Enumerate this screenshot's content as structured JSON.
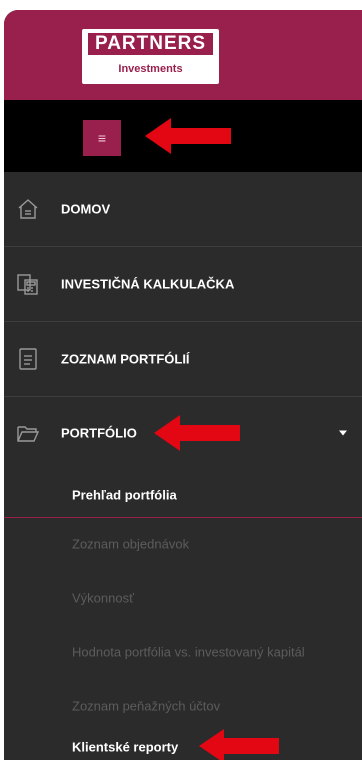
{
  "brand": {
    "line1": "PARTNERS",
    "line2": "Investments"
  },
  "menu_toggle": {
    "icon": "≡"
  },
  "nav": {
    "items": [
      {
        "label": "DOMOV",
        "icon": "home-icon"
      },
      {
        "label": "INVESTIČNÁ KALKULAČKA",
        "icon": "calculator-icon"
      },
      {
        "label": "ZOZNAM PORTFÓLIÍ",
        "icon": "document-list-icon"
      },
      {
        "label": "PORTFÓLIO",
        "icon": "folder-icon"
      }
    ]
  },
  "submenu": {
    "items": [
      {
        "label": "Prehľad portfólia",
        "state": "active"
      },
      {
        "label": "Zoznam objednávok",
        "state": "muted"
      },
      {
        "label": "Výkonnosť",
        "state": "muted"
      },
      {
        "label": "Hodnota portfólia vs. investovaný kapitál",
        "state": "muted"
      },
      {
        "label": "Zoznam peňažných účtov",
        "state": "muted"
      },
      {
        "label": "Klientské reporty",
        "state": "active"
      }
    ]
  },
  "colors": {
    "brand": "#99204c",
    "sidebar": "#2b2b2b",
    "topbar": "#000000",
    "arrow": "#e30613",
    "muted_text": "#5c5c5c"
  }
}
